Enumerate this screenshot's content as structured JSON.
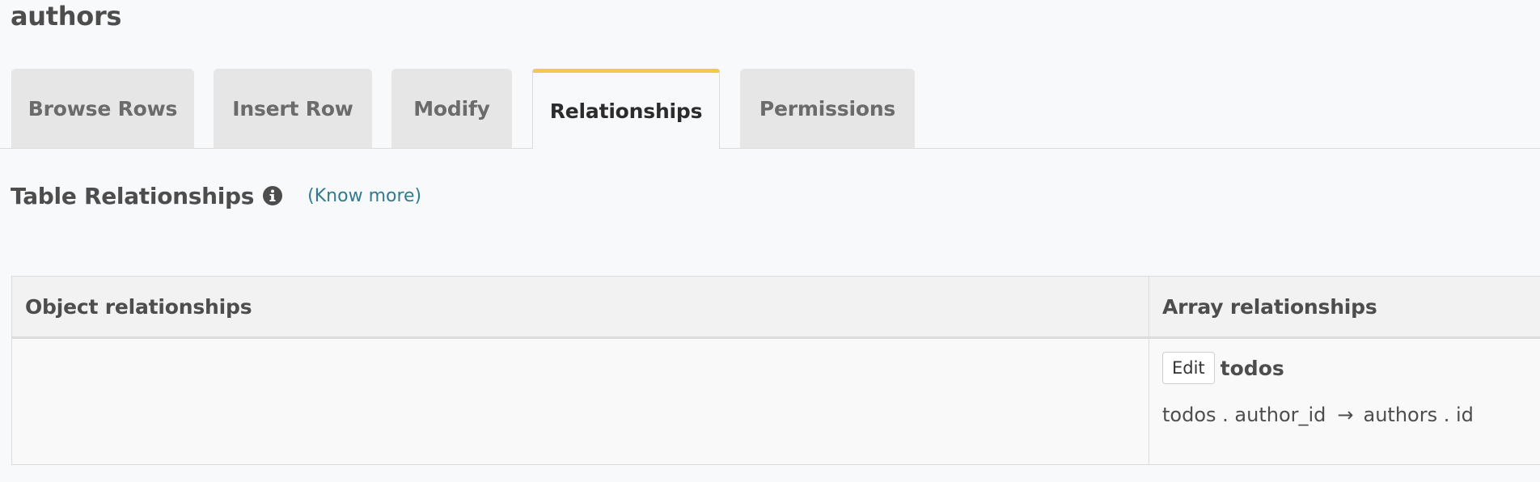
{
  "page": {
    "title": "authors"
  },
  "tabs": [
    {
      "label": "Browse Rows",
      "active": false
    },
    {
      "label": "Insert Row",
      "active": false
    },
    {
      "label": "Modify",
      "active": false
    },
    {
      "label": "Relationships",
      "active": true
    },
    {
      "label": "Permissions",
      "active": false
    }
  ],
  "section": {
    "title": "Table Relationships",
    "info_icon": "info-icon",
    "know_more": "(Know more)"
  },
  "table": {
    "columns": [
      "Object relationships",
      "Array relationships"
    ],
    "object_relationships": [],
    "array_relationships": [
      {
        "edit_label": "Edit",
        "name": "todos",
        "from": "todos . author_id",
        "arrow": "→",
        "to": "authors . id"
      }
    ]
  },
  "colors": {
    "active_tab_accent": "#f2c94c",
    "link": "#337a8d"
  }
}
